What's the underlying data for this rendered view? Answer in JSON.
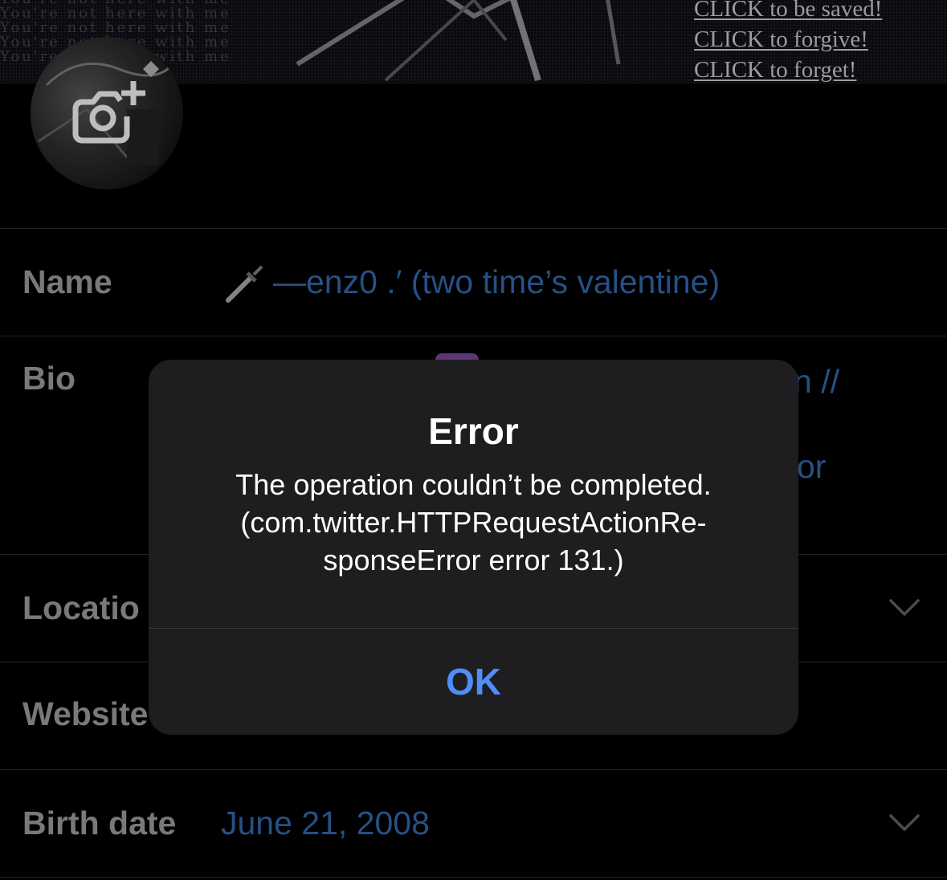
{
  "banner": {
    "bg_text": "You're not here with me\nYou're not here with me\nYou're not here with me\nYou're not here with me\nYou're not here with me",
    "links": [
      "CLICK to be saved!",
      "CLICK to forgive!",
      "CLICK to forget!"
    ]
  },
  "avatar": {
    "icon": "camera-add-icon"
  },
  "fields": {
    "name": {
      "label": "Name",
      "value": "—enz0 .′ (two time’s valentine)",
      "icon": "dagger-icon"
    },
    "bio": {
      "label": "Bio",
      "fragment_1": "n //",
      "fragment_2": "or"
    },
    "location": {
      "label": "Locatio"
    },
    "website": {
      "label": "Website"
    },
    "birth_date": {
      "label": "Birth date",
      "value": "June 21, 2008"
    }
  },
  "alert": {
    "title": "Error",
    "message_lines": [
      "The operation couldn’t be completed.",
      "(com.twitter.HTTPRequestActionRe-",
      "sponseError error 131.)"
    ],
    "ok_label": "OK"
  },
  "colors": {
    "background": "#000000",
    "label": "#8f8f8f",
    "value": "#2d5f9e",
    "alert_bg": "#1e1e20",
    "alert_button": "#4f8ef7"
  }
}
